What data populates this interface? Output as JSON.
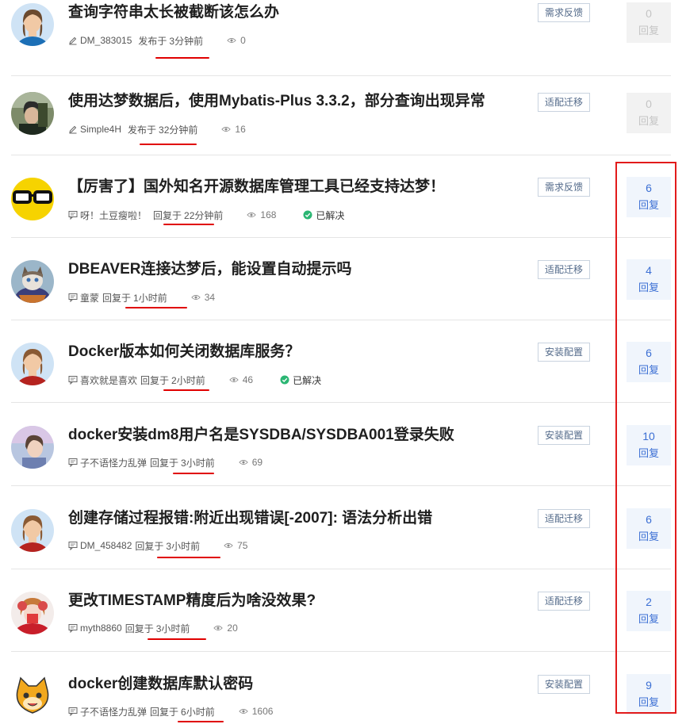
{
  "colors": {
    "accent": "#3b6fd4",
    "annotation_red": "#e00000",
    "tag_text": "#536a8a"
  },
  "reply_label": "回复",
  "solved_label": "已解决",
  "posts": [
    {
      "title": "查询字符串太长被截断该怎么办",
      "user": "DM_383015",
      "action": "发布于",
      "time": "3分钟前",
      "views": "0",
      "tag": "需求反馈",
      "replies": "0",
      "user_icon": "pencil-icon",
      "solved": false
    },
    {
      "title": "使用达梦数据后，使用Mybatis-Plus 3.3.2，部分查询出现异常",
      "user": "Simple4H",
      "action": "发布于",
      "time": "32分钟前",
      "views": "16",
      "tag": "适配迁移",
      "replies": "0",
      "user_icon": "pencil-icon",
      "solved": false
    },
    {
      "title": "【厉害了】国外知名开源数据库管理工具已经支持达梦！",
      "user": "呀！土豆瘦啦！",
      "action": "回复于",
      "time": "22分钟前",
      "views": "168",
      "tag": "需求反馈",
      "replies": "6",
      "user_icon": "comment-icon",
      "solved": true
    },
    {
      "title": "DBEAVER连接达梦后，能设置自动提示吗",
      "user": "童蒙",
      "action": "回复于",
      "time": "1小时前",
      "views": "34",
      "tag": "适配迁移",
      "replies": "4",
      "user_icon": "comment-icon",
      "solved": false
    },
    {
      "title": "Docker版本如何关闭数据库服务？",
      "user": "喜欢就是喜欢",
      "action": "回复于",
      "time": "2小时前",
      "views": "46",
      "tag": "安装配置",
      "replies": "6",
      "user_icon": "comment-icon",
      "solved": true
    },
    {
      "title": "docker安装dm8用户名是SYSDBA/SYSDBA001登录失败",
      "user": "子不语怪力乱弹",
      "action": "回复于",
      "time": "3小时前",
      "views": "69",
      "tag": "安装配置",
      "replies": "10",
      "user_icon": "comment-icon",
      "solved": false
    },
    {
      "title": "创建存储过程报错:附近出现错误[-2007]: 语法分析出错",
      "user": "DM_458482",
      "action": "回复于",
      "time": "3小时前",
      "views": "75",
      "tag": "适配迁移",
      "replies": "6",
      "user_icon": "comment-icon",
      "solved": false
    },
    {
      "title": "更改TIMESTAMP精度后为啥没效果?",
      "user": "myth8860",
      "action": "回复于",
      "time": "3小时前",
      "views": "20",
      "tag": "适配迁移",
      "replies": "2",
      "user_icon": "comment-icon",
      "solved": false
    },
    {
      "title": "docker创建数据库默认密码",
      "user": "子不语怪力乱弹",
      "action": "回复于",
      "time": "6小时前",
      "views": "1606",
      "tag": "安装配置",
      "replies": "9",
      "user_icon": "comment-icon",
      "solved": false
    }
  ]
}
